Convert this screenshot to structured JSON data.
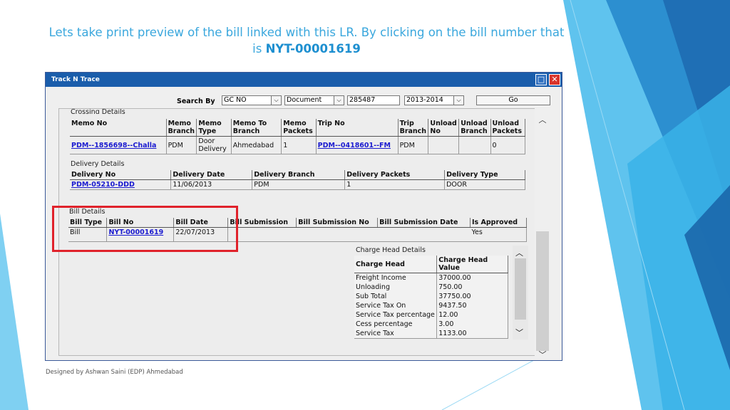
{
  "slide": {
    "title_text": "Lets take print preview of the bill linked with this LR. By clicking on the bill number that is",
    "title_highlight": "NYT-00001619",
    "footer": "Designed by Ashwan Saini (EDP) Ahmedabad"
  },
  "window": {
    "title": "Track N Trace",
    "maximize_glyph": "□",
    "close_glyph": "✕"
  },
  "search": {
    "label": "Search By",
    "search_by_value": "GC NO",
    "document_value": "Document",
    "number_value": "285487",
    "year_value": "2013-2014",
    "go_label": "Go"
  },
  "crossing": {
    "label": "Crossing Details",
    "headers": [
      "Memo No",
      "Memo Branch",
      "Memo Type",
      "Memo To Branch",
      "Memo Packets",
      "Trip No",
      "Trip Branch",
      "Unload No",
      "Unload Branch",
      "Unload Packets"
    ],
    "row": [
      "PDM--1856698--Challa",
      "PDM",
      "Door Delivery",
      "Ahmedabad",
      "1",
      "PDM--0418601--FM",
      "PDM",
      "",
      "",
      "0"
    ]
  },
  "delivery": {
    "label": "Delivery Details",
    "headers": [
      "Delivery No",
      "Delivery Date",
      "Delivery Branch",
      "Delivery Packets",
      "Delivery Type"
    ],
    "row": [
      "PDM-05210-DDD",
      "11/06/2013",
      "PDM",
      "1",
      "DOOR"
    ]
  },
  "bill": {
    "label": "Bill Details",
    "headers": [
      "Bill Type",
      "Bill No",
      "Bill Date",
      "Bill Submission",
      "Bill Submission No",
      "Bill Submission Date",
      "Is Approved"
    ],
    "row": [
      "Bill",
      "NYT-00001619",
      "22/07/2013",
      "",
      "",
      "",
      "Yes"
    ]
  },
  "charges": {
    "label": "Charge Head Details",
    "headers": [
      "Charge Head",
      "Charge Head Value"
    ],
    "rows": [
      [
        "Freight Income",
        "37000.00"
      ],
      [
        "Unloading",
        "750.00"
      ],
      [
        "Sub Total",
        "37750.00"
      ],
      [
        "Service Tax On",
        "9437.50"
      ],
      [
        "Service Tax percentage",
        "12.00"
      ],
      [
        "Cess percentage",
        "3.00"
      ],
      [
        "Service Tax",
        "1133.00"
      ]
    ]
  },
  "icons": {
    "chevron_up": "︿",
    "chevron_down": "﹀",
    "dropdown": "⌵"
  }
}
